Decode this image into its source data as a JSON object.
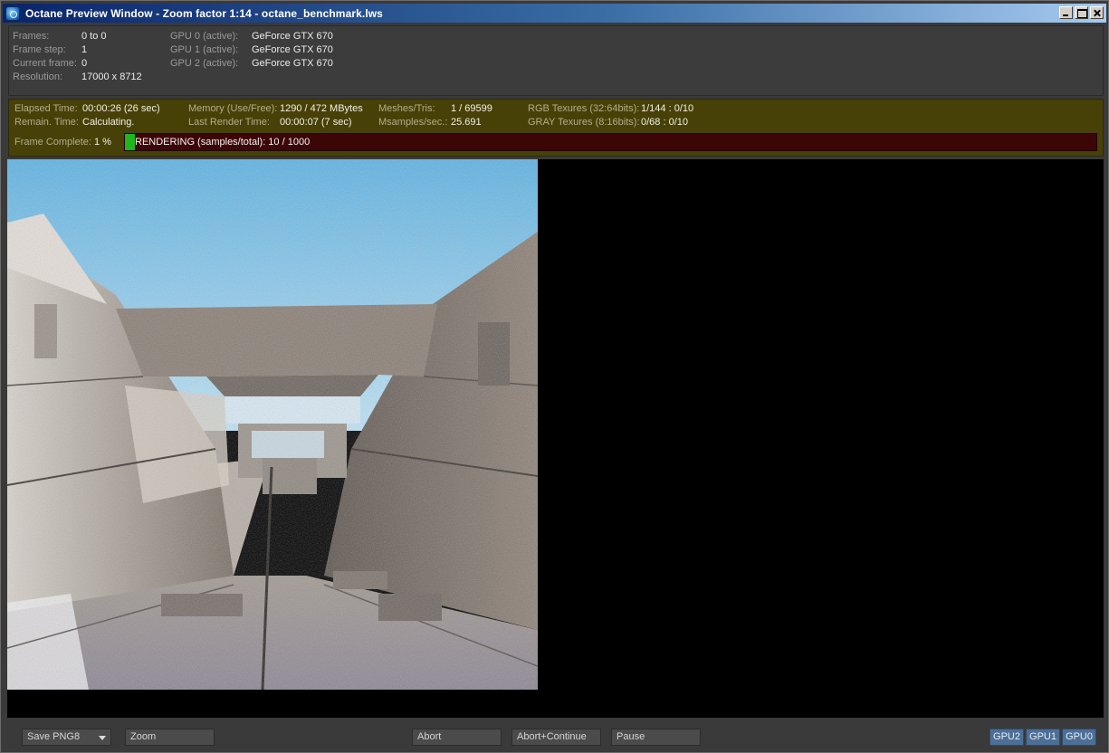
{
  "window": {
    "title": "Octane Preview Window - Zoom factor 1:14 - octane_benchmark.lws"
  },
  "info": {
    "frames_label": "Frames:",
    "frames_value": "0 to 0",
    "frame_step_label": "Frame step:",
    "frame_step_value": "1",
    "current_frame_label": "Current frame:",
    "current_frame_value": "0",
    "resolution_label": "Resolution:",
    "resolution_value": "17000 x 8712",
    "gpus": [
      {
        "label": "GPU  0 (active):",
        "value": "GeForce GTX 670"
      },
      {
        "label": "GPU  1 (active):",
        "value": "GeForce GTX 670"
      },
      {
        "label": "GPU  2 (active):",
        "value": "GeForce GTX 670"
      }
    ]
  },
  "stats": {
    "elapsed_label": "Elapsed Time:",
    "elapsed_value": "00:00:26 (26 sec)",
    "remain_label": "Remain. Time:",
    "remain_value": "Calculating.",
    "memory_label": "Memory (Use/Free):",
    "memory_value": "1290 / 472 MBytes",
    "last_render_label": "Last Render Time:",
    "last_render_value": "00:00:07 (7 sec)",
    "meshes_label": "Meshes/Tris:",
    "meshes_value": "1 / 69599",
    "msamples_label": "Msamples/sec.:",
    "msamples_value": "25.691",
    "rgb_tex_label": "RGB Texures (32:64bits):",
    "rgb_tex_value": "1/144 : 0/10",
    "gray_tex_label": "GRAY Texures (8:16bits):",
    "gray_tex_value": "0/68 : 0/10",
    "frame_complete_label": "Frame Complete:",
    "frame_complete_value": "1 %",
    "rendering_text": "RENDERING (samples/total): 10 / 1000",
    "progress_fraction": 0.01
  },
  "toolbar": {
    "save_format": "Save PNG8",
    "zoom_label": "Zoom",
    "abort_label": "Abort",
    "abort_continue_label": "Abort+Continue",
    "pause_label": "Pause",
    "gpu_buttons": [
      "GPU2",
      "GPU1",
      "GPU0"
    ]
  },
  "colors": {
    "title_bar": "#0a246a",
    "stats_panel": "#474108",
    "progress_track": "#3d0606",
    "progress_fill": "#1fb51f",
    "gpu_button": "#4d6f96"
  }
}
